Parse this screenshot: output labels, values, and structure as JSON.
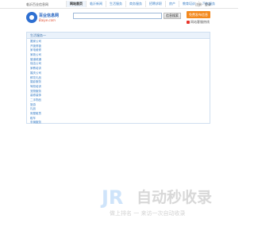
{
  "topbar": {
    "site_name": "临沂百业信息网",
    "right_links": "注册 · 登录",
    "nav": [
      {
        "label": "网站首页",
        "active": true
      },
      {
        "label": "临沂新闻",
        "active": false
      },
      {
        "label": "生活服务",
        "active": false
      },
      {
        "label": "商务服务",
        "active": false
      },
      {
        "label": "招聘求职",
        "active": false
      },
      {
        "label": "房产",
        "active": false
      },
      {
        "label": "教育培训",
        "active": false
      },
      {
        "label": "汽车服务",
        "active": false
      }
    ]
  },
  "logo": {
    "title": "百业信息网",
    "subtitle": "Baiye.com",
    "icon": "globe-icon",
    "brand_color": "#2e6fd1"
  },
  "search": {
    "value": "",
    "placeholder": "",
    "button_label": "信息搜索"
  },
  "actions": {
    "submit_label": "免费发布信息",
    "contact_label": "网站客服热线"
  },
  "panel": {
    "header": "生活服务一",
    "items": [
      "搬家公司",
      "开锁修锁",
      "家电维修",
      "家政公司",
      "管道疏通",
      "保洁公司",
      "家教培训",
      "婚庆公司",
      "鲜花礼品",
      "摄影服务",
      "驾校培训",
      "宠物服务",
      "装修装饰",
      "二手物品",
      "旅游",
      "礼品",
      "房屋租赁",
      "租车",
      "车辆服务"
    ]
  },
  "watermark": {
    "logo": "JR",
    "title": "自动秒收录",
    "subtitle": "做上排名 一 来访一次自动收录"
  },
  "colors": {
    "accent": "#3a7fc7",
    "submit": "#f3891e",
    "panel_header_bg": "#eaf2fb"
  }
}
